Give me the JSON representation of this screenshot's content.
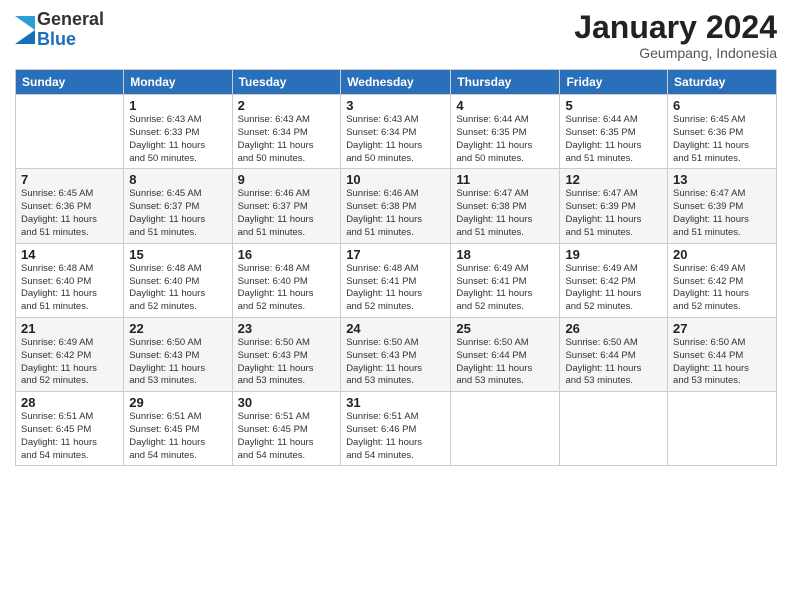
{
  "logo": {
    "general": "General",
    "blue": "Blue"
  },
  "title": "January 2024",
  "location": "Geumpang, Indonesia",
  "days_header": [
    "Sunday",
    "Monday",
    "Tuesday",
    "Wednesday",
    "Thursday",
    "Friday",
    "Saturday"
  ],
  "weeks": [
    [
      {
        "day": "",
        "sunrise": "",
        "sunset": "",
        "daylight": ""
      },
      {
        "day": "1",
        "sunrise": "Sunrise: 6:43 AM",
        "sunset": "Sunset: 6:33 PM",
        "daylight": "Daylight: 11 hours and 50 minutes."
      },
      {
        "day": "2",
        "sunrise": "Sunrise: 6:43 AM",
        "sunset": "Sunset: 6:34 PM",
        "daylight": "Daylight: 11 hours and 50 minutes."
      },
      {
        "day": "3",
        "sunrise": "Sunrise: 6:43 AM",
        "sunset": "Sunset: 6:34 PM",
        "daylight": "Daylight: 11 hours and 50 minutes."
      },
      {
        "day": "4",
        "sunrise": "Sunrise: 6:44 AM",
        "sunset": "Sunset: 6:35 PM",
        "daylight": "Daylight: 11 hours and 50 minutes."
      },
      {
        "day": "5",
        "sunrise": "Sunrise: 6:44 AM",
        "sunset": "Sunset: 6:35 PM",
        "daylight": "Daylight: 11 hours and 51 minutes."
      },
      {
        "day": "6",
        "sunrise": "Sunrise: 6:45 AM",
        "sunset": "Sunset: 6:36 PM",
        "daylight": "Daylight: 11 hours and 51 minutes."
      }
    ],
    [
      {
        "day": "7",
        "sunrise": "Sunrise: 6:45 AM",
        "sunset": "Sunset: 6:36 PM",
        "daylight": "Daylight: 11 hours and 51 minutes."
      },
      {
        "day": "8",
        "sunrise": "Sunrise: 6:45 AM",
        "sunset": "Sunset: 6:37 PM",
        "daylight": "Daylight: 11 hours and 51 minutes."
      },
      {
        "day": "9",
        "sunrise": "Sunrise: 6:46 AM",
        "sunset": "Sunset: 6:37 PM",
        "daylight": "Daylight: 11 hours and 51 minutes."
      },
      {
        "day": "10",
        "sunrise": "Sunrise: 6:46 AM",
        "sunset": "Sunset: 6:38 PM",
        "daylight": "Daylight: 11 hours and 51 minutes."
      },
      {
        "day": "11",
        "sunrise": "Sunrise: 6:47 AM",
        "sunset": "Sunset: 6:38 PM",
        "daylight": "Daylight: 11 hours and 51 minutes."
      },
      {
        "day": "12",
        "sunrise": "Sunrise: 6:47 AM",
        "sunset": "Sunset: 6:39 PM",
        "daylight": "Daylight: 11 hours and 51 minutes."
      },
      {
        "day": "13",
        "sunrise": "Sunrise: 6:47 AM",
        "sunset": "Sunset: 6:39 PM",
        "daylight": "Daylight: 11 hours and 51 minutes."
      }
    ],
    [
      {
        "day": "14",
        "sunrise": "Sunrise: 6:48 AM",
        "sunset": "Sunset: 6:40 PM",
        "daylight": "Daylight: 11 hours and 51 minutes."
      },
      {
        "day": "15",
        "sunrise": "Sunrise: 6:48 AM",
        "sunset": "Sunset: 6:40 PM",
        "daylight": "Daylight: 11 hours and 52 minutes."
      },
      {
        "day": "16",
        "sunrise": "Sunrise: 6:48 AM",
        "sunset": "Sunset: 6:40 PM",
        "daylight": "Daylight: 11 hours and 52 minutes."
      },
      {
        "day": "17",
        "sunrise": "Sunrise: 6:48 AM",
        "sunset": "Sunset: 6:41 PM",
        "daylight": "Daylight: 11 hours and 52 minutes."
      },
      {
        "day": "18",
        "sunrise": "Sunrise: 6:49 AM",
        "sunset": "Sunset: 6:41 PM",
        "daylight": "Daylight: 11 hours and 52 minutes."
      },
      {
        "day": "19",
        "sunrise": "Sunrise: 6:49 AM",
        "sunset": "Sunset: 6:42 PM",
        "daylight": "Daylight: 11 hours and 52 minutes."
      },
      {
        "day": "20",
        "sunrise": "Sunrise: 6:49 AM",
        "sunset": "Sunset: 6:42 PM",
        "daylight": "Daylight: 11 hours and 52 minutes."
      }
    ],
    [
      {
        "day": "21",
        "sunrise": "Sunrise: 6:49 AM",
        "sunset": "Sunset: 6:42 PM",
        "daylight": "Daylight: 11 hours and 52 minutes."
      },
      {
        "day": "22",
        "sunrise": "Sunrise: 6:50 AM",
        "sunset": "Sunset: 6:43 PM",
        "daylight": "Daylight: 11 hours and 53 minutes."
      },
      {
        "day": "23",
        "sunrise": "Sunrise: 6:50 AM",
        "sunset": "Sunset: 6:43 PM",
        "daylight": "Daylight: 11 hours and 53 minutes."
      },
      {
        "day": "24",
        "sunrise": "Sunrise: 6:50 AM",
        "sunset": "Sunset: 6:43 PM",
        "daylight": "Daylight: 11 hours and 53 minutes."
      },
      {
        "day": "25",
        "sunrise": "Sunrise: 6:50 AM",
        "sunset": "Sunset: 6:44 PM",
        "daylight": "Daylight: 11 hours and 53 minutes."
      },
      {
        "day": "26",
        "sunrise": "Sunrise: 6:50 AM",
        "sunset": "Sunset: 6:44 PM",
        "daylight": "Daylight: 11 hours and 53 minutes."
      },
      {
        "day": "27",
        "sunrise": "Sunrise: 6:50 AM",
        "sunset": "Sunset: 6:44 PM",
        "daylight": "Daylight: 11 hours and 53 minutes."
      }
    ],
    [
      {
        "day": "28",
        "sunrise": "Sunrise: 6:51 AM",
        "sunset": "Sunset: 6:45 PM",
        "daylight": "Daylight: 11 hours and 54 minutes."
      },
      {
        "day": "29",
        "sunrise": "Sunrise: 6:51 AM",
        "sunset": "Sunset: 6:45 PM",
        "daylight": "Daylight: 11 hours and 54 minutes."
      },
      {
        "day": "30",
        "sunrise": "Sunrise: 6:51 AM",
        "sunset": "Sunset: 6:45 PM",
        "daylight": "Daylight: 11 hours and 54 minutes."
      },
      {
        "day": "31",
        "sunrise": "Sunrise: 6:51 AM",
        "sunset": "Sunset: 6:46 PM",
        "daylight": "Daylight: 11 hours and 54 minutes."
      },
      {
        "day": "",
        "sunrise": "",
        "sunset": "",
        "daylight": ""
      },
      {
        "day": "",
        "sunrise": "",
        "sunset": "",
        "daylight": ""
      },
      {
        "day": "",
        "sunrise": "",
        "sunset": "",
        "daylight": ""
      }
    ]
  ]
}
